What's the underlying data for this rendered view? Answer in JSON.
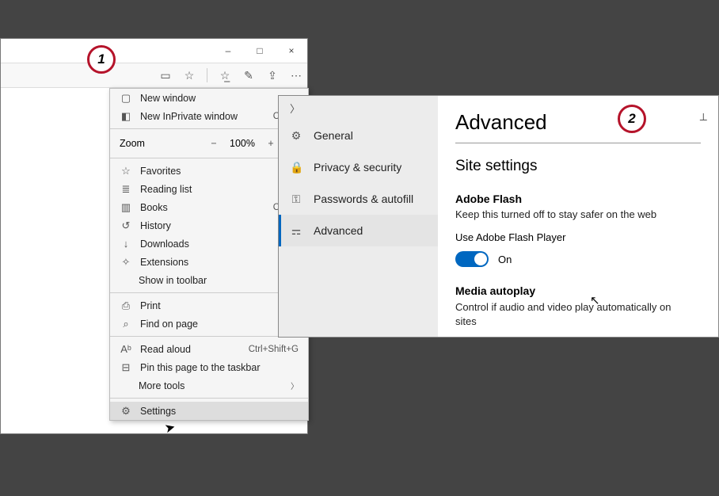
{
  "steps": {
    "one": "1",
    "two": "2"
  },
  "window": {
    "min": "–",
    "max": "□",
    "close": "×"
  },
  "menu": {
    "new_window": "New window",
    "new_inprivate": "New InPrivate window",
    "new_inprivate_sc": "Ctrl+S",
    "zoom_label": "Zoom",
    "zoom_minus": "−",
    "zoom_val": "100%",
    "zoom_plus": "+",
    "zoom_full": "⛶",
    "favorites": "Favorites",
    "reading_list": "Reading list",
    "books": "Books",
    "books_sc": "Ctrl+S",
    "history": "History",
    "downloads": "Downloads",
    "extensions": "Extensions",
    "show_in_toolbar": "Show in toolbar",
    "print": "Print",
    "find_page": "Find on page",
    "read_aloud": "Read aloud",
    "read_aloud_sc": "Ctrl+Shift+G",
    "pin_taskbar": "Pin this page to the taskbar",
    "more_tools": "More tools",
    "settings": "Settings"
  },
  "settings_side": {
    "general": "General",
    "privacy": "Privacy & security",
    "passwords": "Passwords & autofill",
    "advanced": "Advanced"
  },
  "settings_main": {
    "title": "Advanced",
    "site_settings": "Site settings",
    "flash_title": "Adobe Flash",
    "flash_sub": "Keep this turned off to stay safer on the web",
    "flash_use": "Use Adobe Flash Player",
    "toggle_state": "On",
    "media_title": "Media autoplay",
    "media_sub": "Control if audio and video play automatically on sites"
  }
}
